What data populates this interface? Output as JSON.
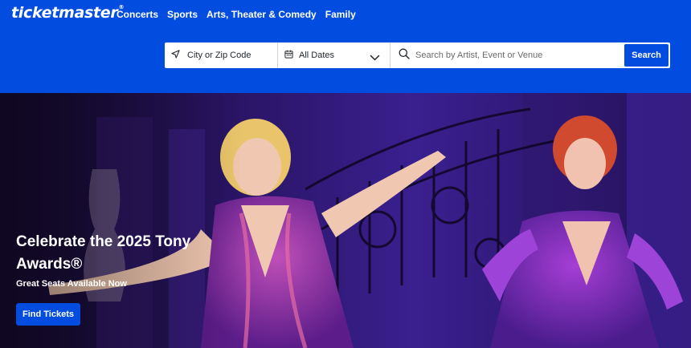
{
  "header": {
    "logo_text": "ticketmaster",
    "logo_mark": "®",
    "nav": [
      {
        "label": "Concerts"
      },
      {
        "label": "Sports"
      },
      {
        "label": "Arts, Theater & Comedy"
      },
      {
        "label": "Family"
      }
    ]
  },
  "search": {
    "location_placeholder": "City or Zip Code",
    "date_value": "All Dates",
    "query_placeholder": "Search by Artist, Event or Venue",
    "button_label": "Search"
  },
  "hero": {
    "title": "Celebrate the 2025 Tony Awards®",
    "subtitle": "Great Seats Available Now",
    "cta_label": "Find Tickets"
  },
  "colors": {
    "brand_blue": "#024ddf",
    "white": "#ffffff"
  },
  "icons": {
    "location": "location-arrow-icon",
    "calendar": "calendar-icon",
    "dropdown": "chevron-down-icon",
    "search": "search-icon"
  }
}
